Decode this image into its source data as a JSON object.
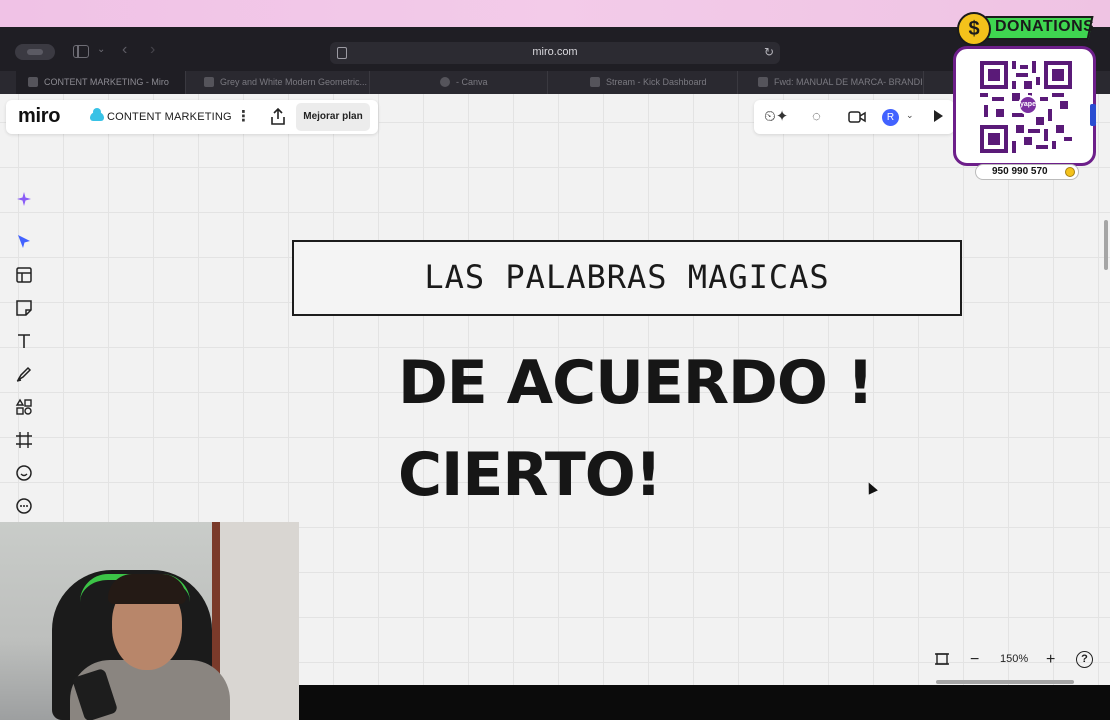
{
  "browser": {
    "url": "miro.com",
    "tabs": [
      {
        "label": "CONTENT MARKETING - Miro",
        "active": true
      },
      {
        "label": "Grey and White Modern Geometric...",
        "active": false
      },
      {
        "label": "- Canva",
        "active": false
      },
      {
        "label": "Stream - Kick Dashboard",
        "active": false
      },
      {
        "label": "Fwd: MANUAL DE MARCA- BRANDI...",
        "active": false
      }
    ]
  },
  "miro": {
    "logo": "miro",
    "board_name": "CONTENT MARKETING",
    "upgrade_label": "Mejorar plan",
    "avatar_initial": "R",
    "zoom_level": "150%",
    "left_tools": [
      "ai-sparkle-icon",
      "select-cursor-icon",
      "templates-icon",
      "sticky-note-icon",
      "text-icon",
      "pen-icon",
      "shapes-icon",
      "frame-icon",
      "sticker-icon",
      "comment-icon"
    ]
  },
  "canvas": {
    "frame_title": "LAS PALABRAS MAGICAS",
    "line1": "DE ACUERDO !",
    "line2": "CIERTO!"
  },
  "overlay": {
    "donations_label": "DONATIONS",
    "phone_number": "950 990 570",
    "qr_logo_text": "yape"
  },
  "colors": {
    "accent_blue": "#4262ff",
    "board_bg": "#f2f2f2",
    "donations_green": "#3fd650",
    "donations_gold": "#f4c21b"
  }
}
